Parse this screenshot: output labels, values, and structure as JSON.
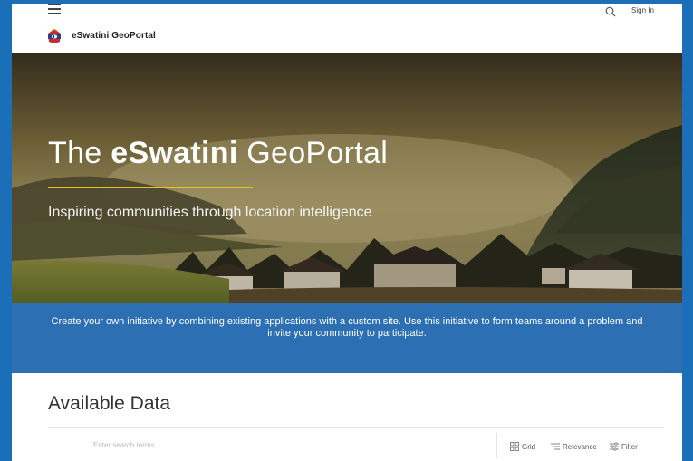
{
  "header": {
    "brand": "eSwatini GeoPortal",
    "signin": "Sign In",
    "icons": [
      "menu-icon",
      "search-icon",
      "logo"
    ]
  },
  "hero": {
    "title_pre": "The ",
    "title_bold": "eSwatini",
    "title_post": " GeoPortal",
    "subtitle": "Inspiring communities through location intelligence",
    "accent_color": "#e6c321"
  },
  "banner": {
    "text": "Create your own initiative by combining existing applications with a custom site. Use this initiative to form teams around a problem and invite your community to participate.",
    "color": "#2d6fb3"
  },
  "data_section": {
    "title": "Available Data",
    "search_placeholder": "Enter search terms",
    "grid_label": "Grid",
    "relevance_label": "Relevance",
    "filter_label": "Filter"
  }
}
